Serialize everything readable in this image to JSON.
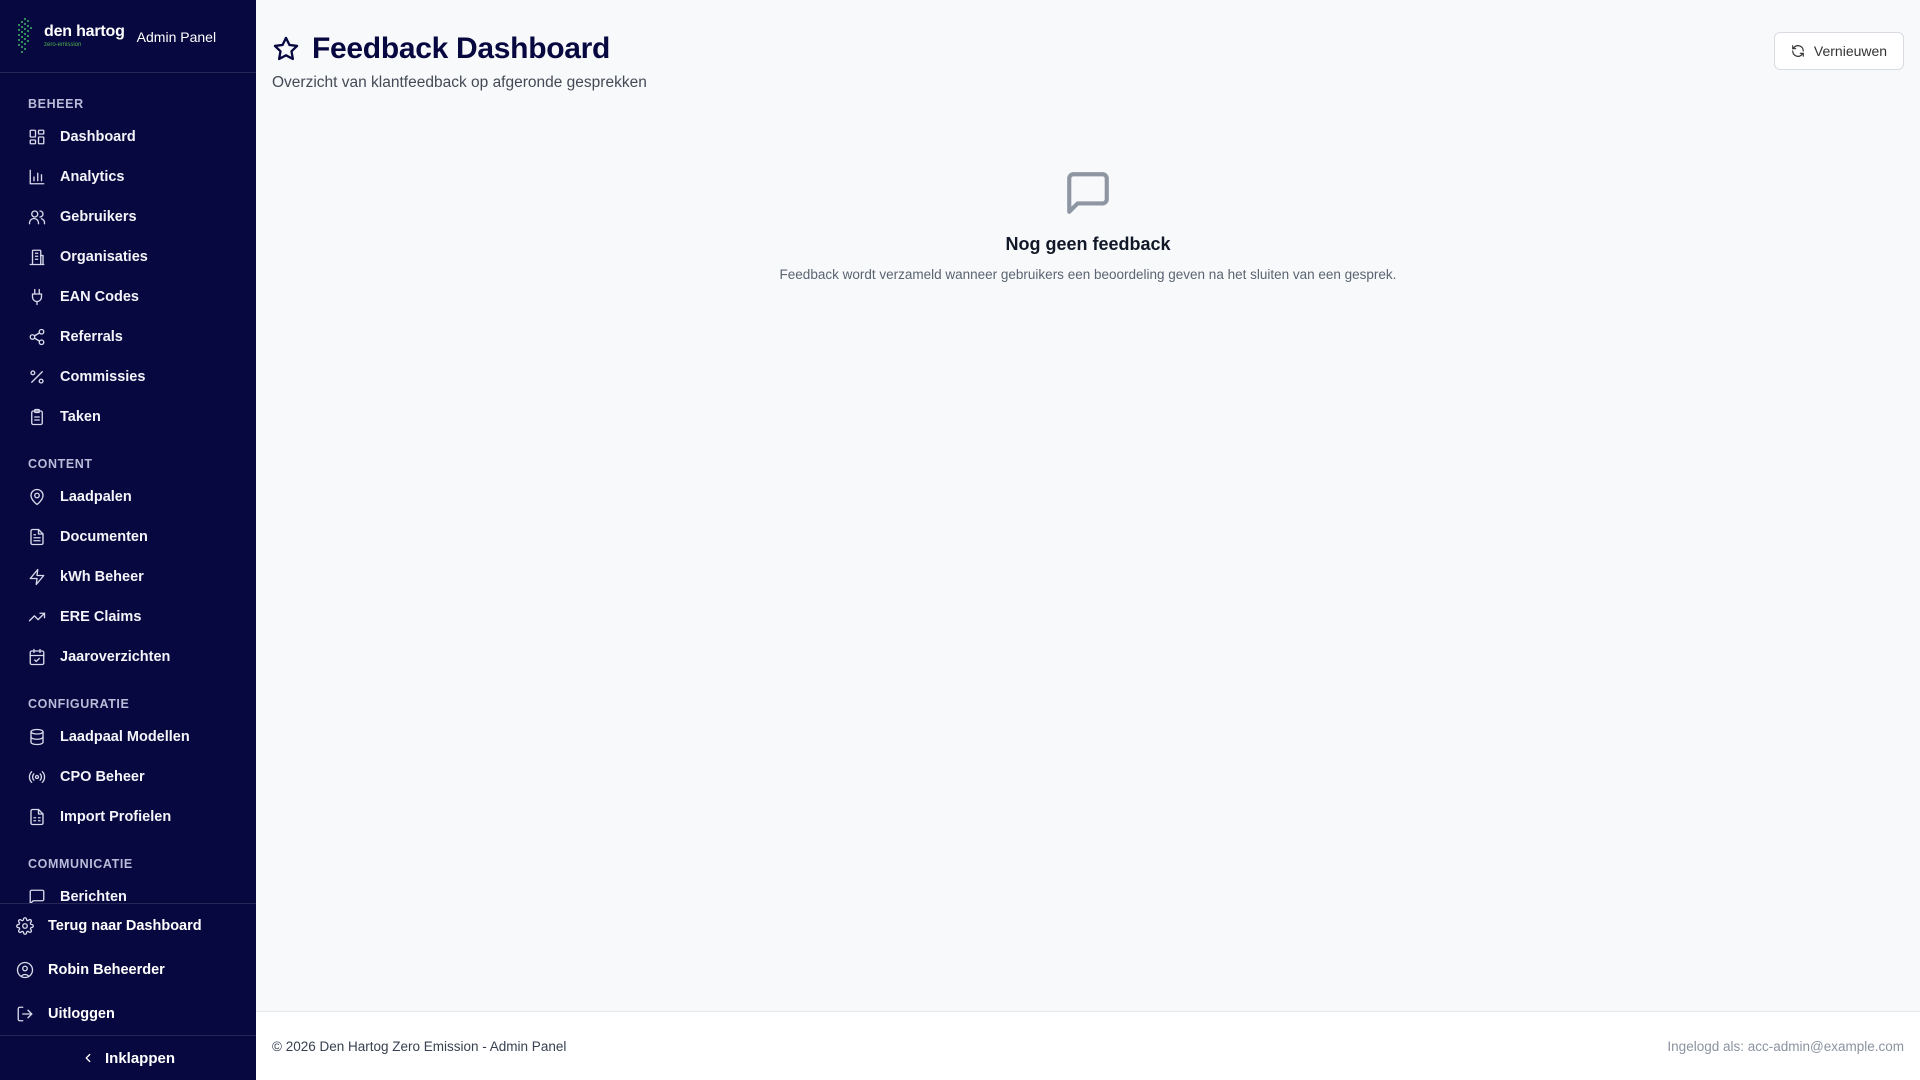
{
  "brand": {
    "name": "den hartog",
    "tagline": "zero-emission",
    "panel": "Admin Panel"
  },
  "sidebar": {
    "sections": [
      {
        "title": "BEHEER",
        "items": [
          {
            "label": "Dashboard",
            "icon": "dashboard-icon"
          },
          {
            "label": "Analytics",
            "icon": "bar-chart-icon"
          },
          {
            "label": "Gebruikers",
            "icon": "users-icon"
          },
          {
            "label": "Organisaties",
            "icon": "building-icon"
          },
          {
            "label": "EAN Codes",
            "icon": "plug-icon"
          },
          {
            "label": "Referrals",
            "icon": "share-icon"
          },
          {
            "label": "Commissies",
            "icon": "percent-icon"
          },
          {
            "label": "Taken",
            "icon": "clipboard-icon"
          }
        ]
      },
      {
        "title": "CONTENT",
        "items": [
          {
            "label": "Laadpalen",
            "icon": "map-pin-icon"
          },
          {
            "label": "Documenten",
            "icon": "file-text-icon"
          },
          {
            "label": "kWh Beheer",
            "icon": "lightning-icon"
          },
          {
            "label": "ERE Claims",
            "icon": "trending-up-icon"
          },
          {
            "label": "Jaaroverzichten",
            "icon": "calendar-check-icon"
          }
        ]
      },
      {
        "title": "CONFIGURATIE",
        "items": [
          {
            "label": "Laadpaal Modellen",
            "icon": "database-icon"
          },
          {
            "label": "CPO Beheer",
            "icon": "radio-icon"
          },
          {
            "label": "Import Profielen",
            "icon": "file-spreadsheet-icon"
          }
        ]
      },
      {
        "title": "COMMUNICATIE",
        "items": [
          {
            "label": "Berichten",
            "icon": "message-icon"
          }
        ]
      }
    ],
    "bottom": [
      {
        "label": "Terug naar Dashboard",
        "icon": "gear-icon"
      },
      {
        "label": "Robin Beheerder",
        "icon": "user-circle-icon"
      },
      {
        "label": "Uitloggen",
        "icon": "logout-icon"
      }
    ],
    "collapse_label": "Inklappen"
  },
  "header": {
    "title": "Feedback Dashboard",
    "subtitle": "Overzicht van klantfeedback op afgeronde gesprekken",
    "refresh_label": "Vernieuwen"
  },
  "empty_state": {
    "title": "Nog geen feedback",
    "text": "Feedback wordt verzameld wanneer gebruikers een beoordeling geven na het sluiten van een gesprek."
  },
  "footer": {
    "copyright": "© 2026 Den Hartog Zero Emission - Admin Panel",
    "logged_in": "Ingelogd als: acc-admin@example.com"
  },
  "colors": {
    "sidebar_bg": "#07083f",
    "accent": "#07083f",
    "page_bg": "#f8f9fb"
  }
}
